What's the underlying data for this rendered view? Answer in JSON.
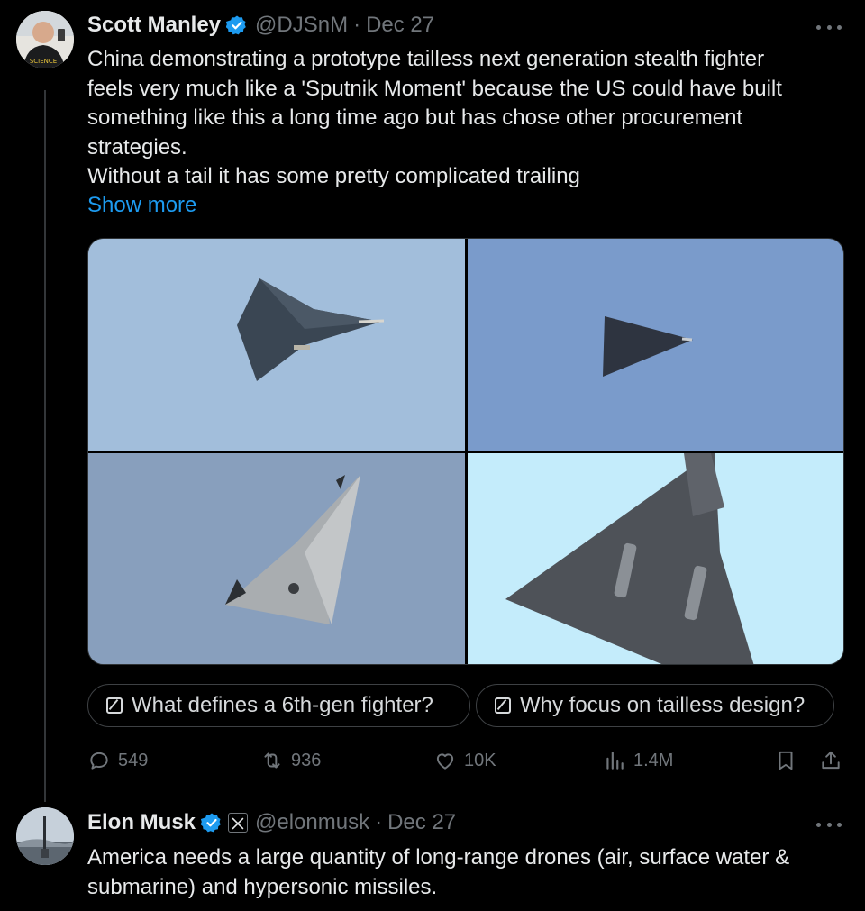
{
  "post1": {
    "name": "Scott Manley",
    "handle": "@DJSnM",
    "separator": "·",
    "date": "Dec 27",
    "text": "China demonstrating a prototype tailless next generation stealth fighter\nfeels very much like a 'Sputnik Moment' because the US could have built\nsomething like this a long time ago but has chose other procurement\nstrategies.\nWithout a tail it has some pretty complicated trailing",
    "show_more": "Show more",
    "chips": [
      {
        "label": "What defines a 6th-gen fighter?"
      },
      {
        "label": "Why focus on tailless design?"
      }
    ],
    "actions": {
      "replies": "549",
      "reposts": "936",
      "likes": "10K",
      "views": "1.4M"
    }
  },
  "post2": {
    "name": "Elon Musk",
    "handle": "@elonmusk",
    "separator": "·",
    "date": "Dec 27",
    "text": "America needs a large quantity of long-range drones (air, surface water &\nsubmarine) and hypersonic missiles."
  },
  "colors": {
    "accent": "#1d9bf0",
    "muted": "#71767b",
    "text": "#e7e9ea",
    "background": "#000000"
  },
  "icons": [
    "verified-badge-icon",
    "x-affiliate-icon",
    "more-icon",
    "reply-icon",
    "repost-icon",
    "like-icon",
    "views-icon",
    "bookmark-icon",
    "share-icon",
    "grok-icon"
  ]
}
